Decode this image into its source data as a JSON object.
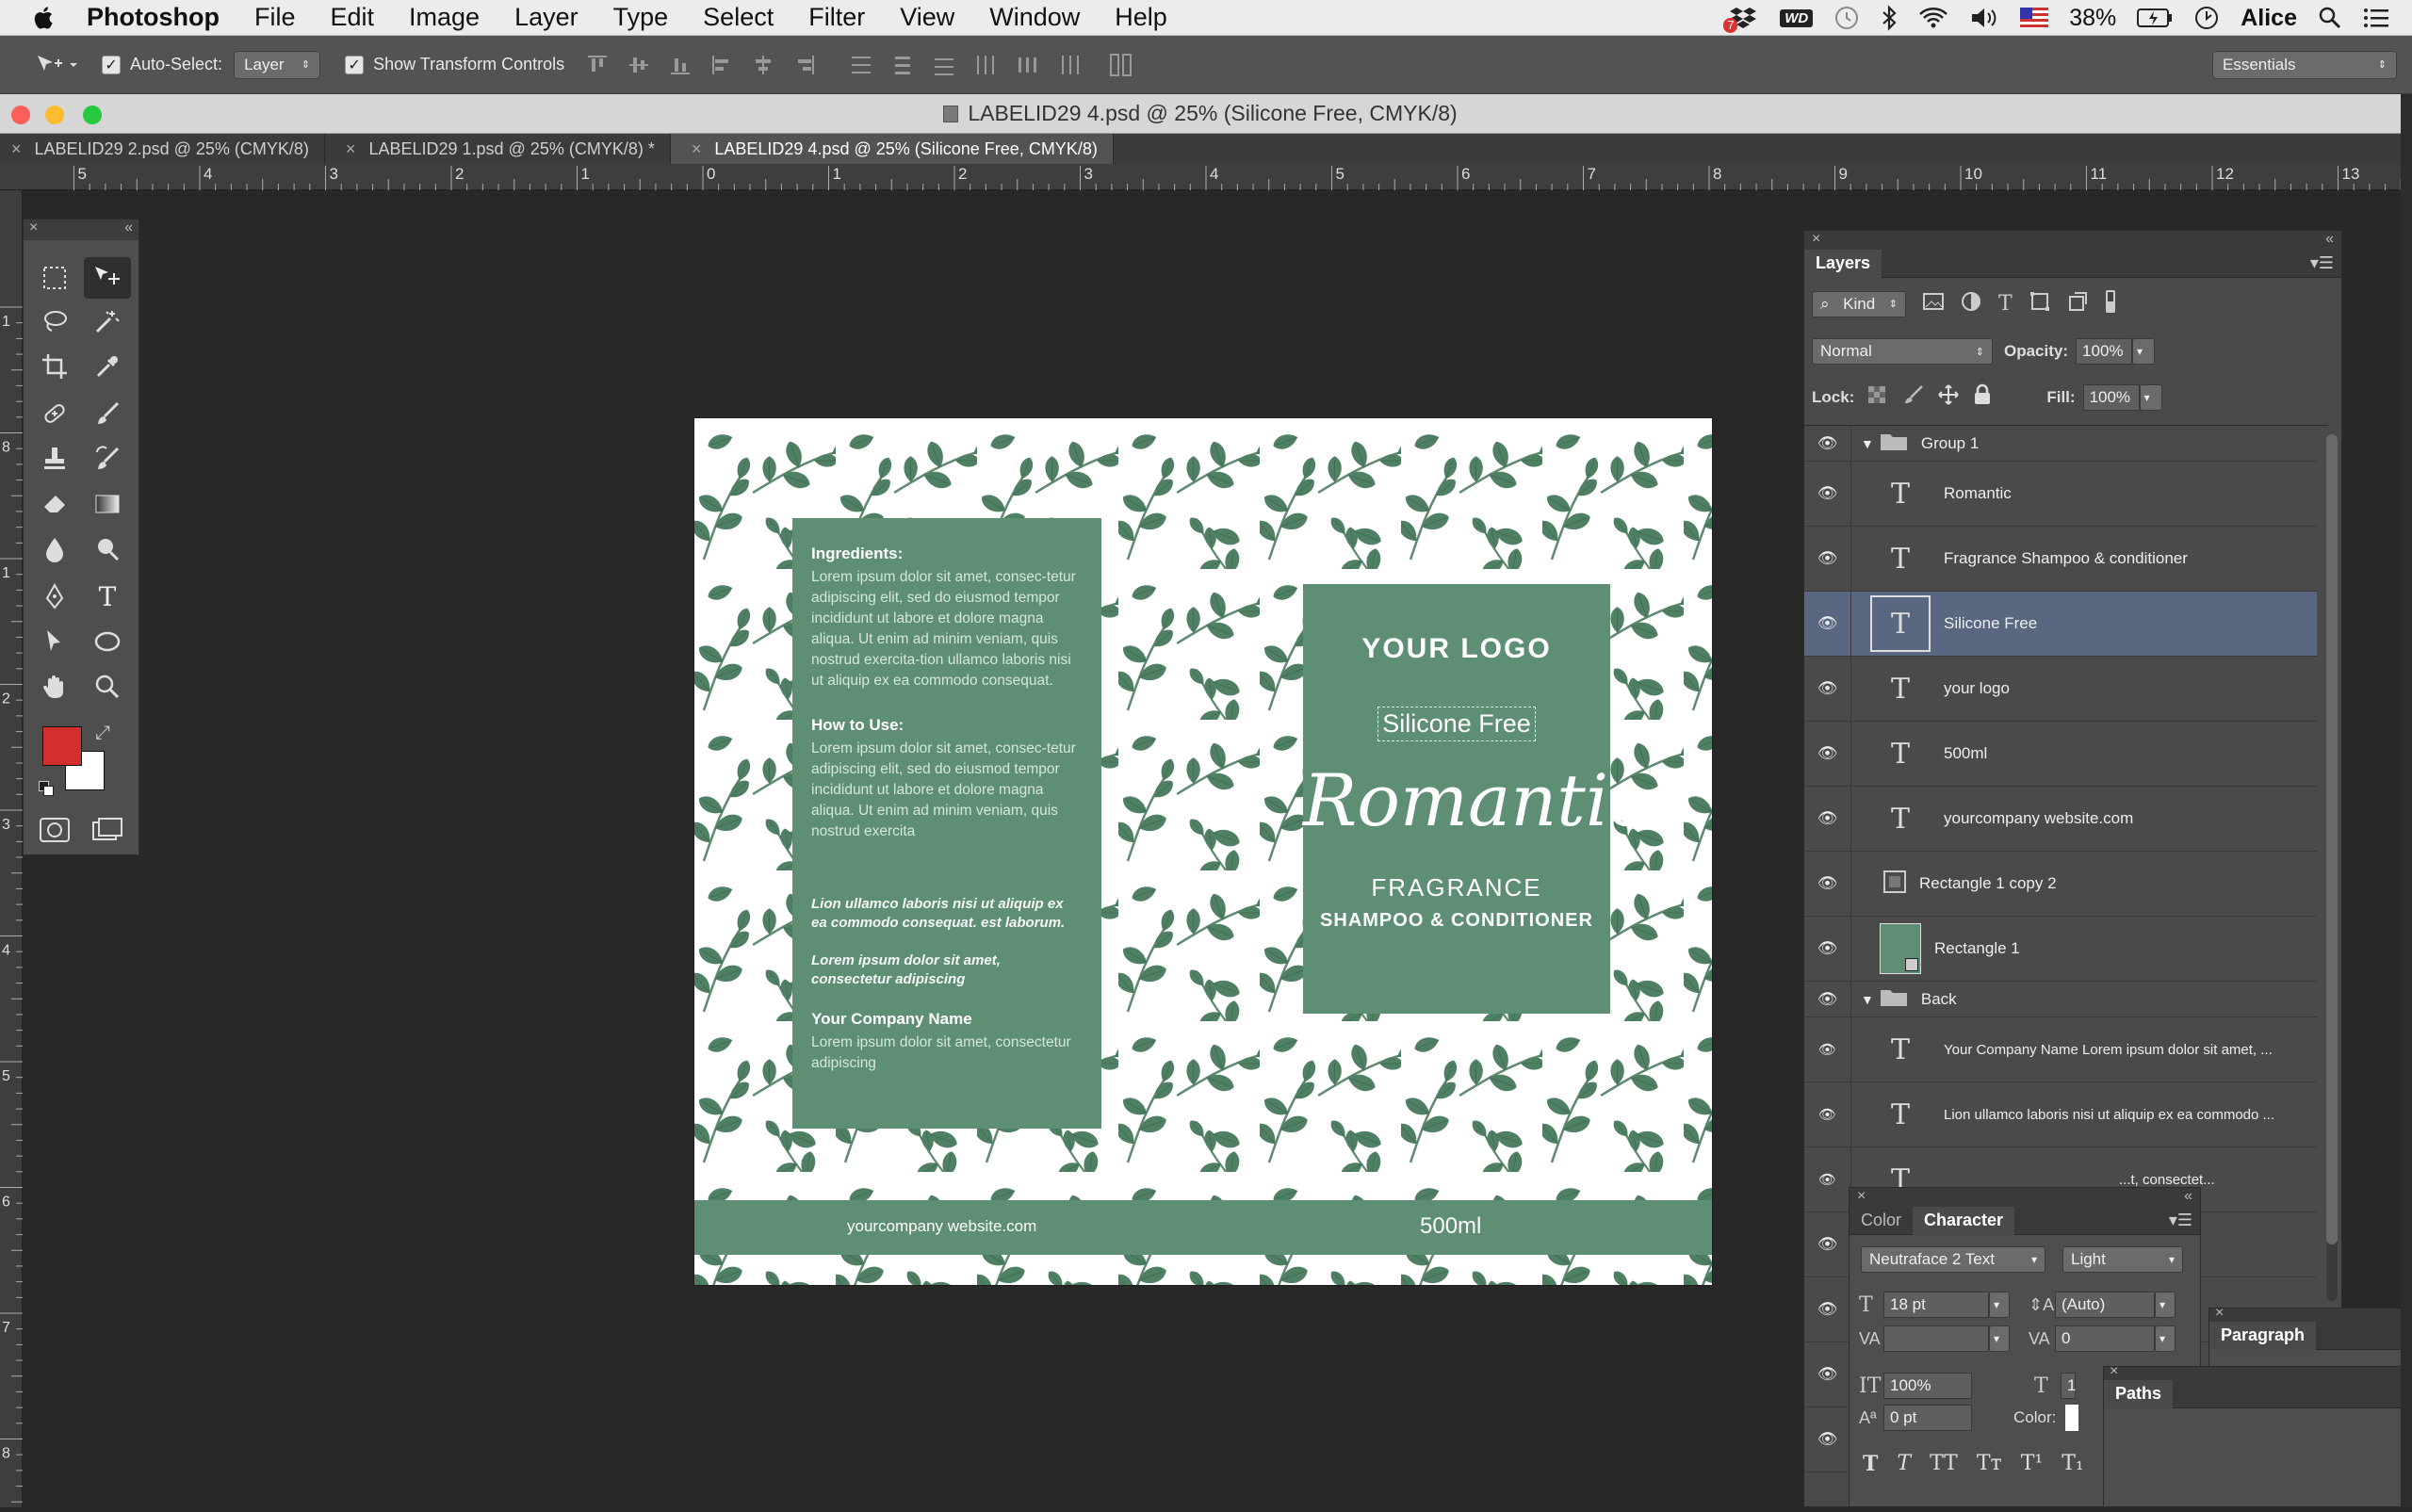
{
  "menubar": {
    "app": "Photoshop",
    "items": [
      "File",
      "Edit",
      "Image",
      "Layer",
      "Type",
      "Select",
      "Filter",
      "View",
      "Window",
      "Help"
    ],
    "status": {
      "badge": "7",
      "wd": "WD",
      "battery": "38%",
      "user": "Alice"
    }
  },
  "options": {
    "auto_select_label": "Auto-Select:",
    "auto_select_value": "Layer",
    "transform_label": "Show Transform Controls",
    "workspace": "Essentials"
  },
  "document": {
    "title": "LABELID29 4.psd @ 25% (Silicone Free, CMYK/8)",
    "tabs": [
      "LABELID29 2.psd @ 25% (CMYK/8)",
      "LABELID29 1.psd @ 25% (CMYK/8) *",
      "LABELID29 4.psd @ 25% (Silicone Free, CMYK/8)"
    ]
  },
  "ruler": {
    "h": [
      "5",
      "4",
      "3",
      "2",
      "1",
      "0",
      "1",
      "2",
      "3",
      "4",
      "5",
      "6",
      "7",
      "8",
      "9",
      "10",
      "11",
      "12",
      "13"
    ],
    "v": [
      "1",
      "8",
      "1",
      "2",
      "3",
      "4",
      "5",
      "6",
      "7",
      "8"
    ]
  },
  "label": {
    "ingredients_title": "Ingredients:",
    "ingredients_text": "Lorem ipsum dolor sit amet, consec-tetur adipiscing elit, sed do eiusmod tempor incididunt ut labore et dolore magna aliqua. Ut enim ad minim veniam, quis nostrud exercita-tion ullamco laboris nisi ut aliquip ex ea commodo consequat.",
    "how_title": "How to Use:",
    "how_text": "Lorem ipsum dolor sit amet, consec-tetur adipiscing elit, sed do eiusmod tempor incididunt ut labore et dolore magna aliqua. Ut enim ad minim veniam, quis nostrud exercita",
    "italic1": "Lion ullamco laboris nisi ut aliquip ex ea commodo consequat. est laborum.",
    "italic2": "Lorem ipsum dolor sit amet, consectetur adipiscing",
    "company_title": "Your Company Name",
    "company_text": "Lorem ipsum dolor sit amet, consectetur adipiscing",
    "logo": "YOUR LOGO",
    "silicone": "Silicone Free",
    "romantic": "Romantic",
    "fragrance": "FRAGRANCE",
    "shampoo": "SHAMPOO & CONDITIONER",
    "website": "yourcompany website.com",
    "volume": "500ml",
    "accent": "#5e8f74"
  },
  "layers": {
    "title": "Layers",
    "kind": "Kind",
    "blend": "Normal",
    "opacity_label": "Opacity:",
    "opacity": "100%",
    "lock_label": "Lock:",
    "fill_label": "Fill:",
    "fill": "100%",
    "rows": [
      "Group 1",
      "Romantic",
      "Fragrance Shampoo & conditioner",
      "Silicone Free",
      "your logo",
      "500ml",
      "yourcompany website.com",
      "Rectangle 1 copy 2",
      "Rectangle 1",
      "Back",
      "Your Company Name Lorem ipsum dolor sit amet, ...",
      "Lion ullamco laboris nisi ut aliquip ex ea commodo ...",
      "...t, consectet..."
    ]
  },
  "character": {
    "tab_color": "Color",
    "tab_character": "Character",
    "font": "Neutraface 2 Text",
    "style": "Light",
    "size": "18 pt",
    "leading": "(Auto)",
    "tracking": "0",
    "vscale": "100%",
    "baseline": "0 pt",
    "hscale": "1",
    "color_label": "Color:"
  },
  "paragraph": {
    "title": "Paragraph"
  },
  "paths": {
    "title": "Paths"
  }
}
